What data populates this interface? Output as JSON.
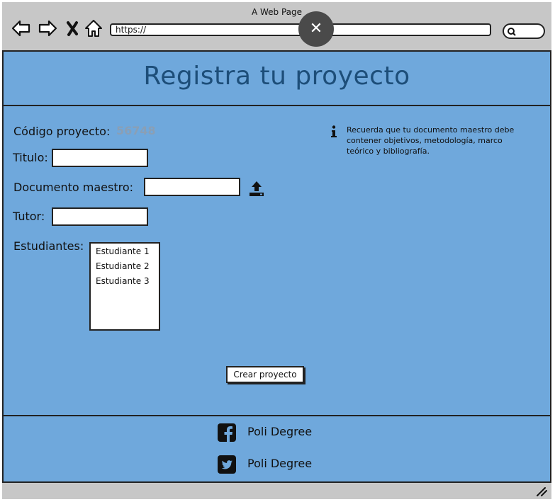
{
  "window": {
    "title": "A Web Page"
  },
  "browser": {
    "url": "https://",
    "close_glyph": "✕"
  },
  "page": {
    "title": "Registra tu proyecto",
    "form": {
      "code_label": "Código proyecto:",
      "code_value": "56748",
      "title_label": "Titulo:",
      "title_value": "",
      "document_label": "Documento maestro:",
      "document_value": "",
      "tutor_label": "Tutor:",
      "tutor_value": "",
      "students_label": "Estudiantes:",
      "students": [
        "Estudiante 1",
        "Estudiante 2",
        "Estudiante 3"
      ],
      "submit_label": "Crear proyecto"
    },
    "info": {
      "text": "Recuerda que tu documento maestro debe contener  objetivos, metodología, marco teórico y bibliografía."
    },
    "footer": {
      "facebook_label": "Poli Degree",
      "twitter_label": "Poli Degree"
    }
  },
  "colors": {
    "page_background": "#6fa8dc",
    "title_color": "#1d4e79",
    "chrome_background": "#c7c7c7"
  }
}
